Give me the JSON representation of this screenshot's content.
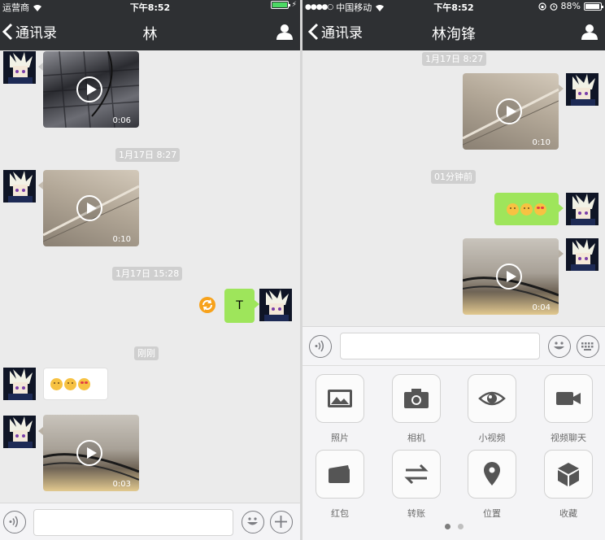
{
  "left": {
    "status": {
      "carrier": "运营商",
      "time": "下午8:52"
    },
    "nav": {
      "back_label": "通讯录",
      "title": "林"
    },
    "messages": {
      "video1_duration": "0:06",
      "stamp1": "1月17日 8:27",
      "video2_duration": "0:10",
      "stamp2": "1月17日 15:28",
      "text_message": "T",
      "stamp3": "刚刚",
      "video3_duration": "0:03"
    },
    "input": {
      "value": ""
    }
  },
  "right": {
    "status": {
      "carrier": "中国移动",
      "time": "下午8:52",
      "battery": "88%"
    },
    "nav": {
      "back_label": "通讯录",
      "title": "林洵锋"
    },
    "messages": {
      "stamp1": "1月17日 8:27",
      "video1_duration": "0:10",
      "stamp2": "01分钟前",
      "video2_duration": "0:04"
    },
    "input": {
      "value": ""
    },
    "tools": [
      {
        "label": "照片",
        "icon": "photo-icon"
      },
      {
        "label": "相机",
        "icon": "camera-icon"
      },
      {
        "label": "小视频",
        "icon": "eye-icon"
      },
      {
        "label": "视频聊天",
        "icon": "video-camera-icon"
      },
      {
        "label": "红包",
        "icon": "red-packet-icon"
      },
      {
        "label": "转账",
        "icon": "transfer-icon"
      },
      {
        "label": "位置",
        "icon": "location-pin-icon"
      },
      {
        "label": "收藏",
        "icon": "cube-icon"
      }
    ],
    "pager": {
      "page": 1,
      "total": 2
    }
  },
  "colors": {
    "navbar": "#2e3033",
    "chat_background": "#ebebeb",
    "sent_bubble": "#9ee55b",
    "timestamp_pill": "#cfcfcf",
    "resend_badge": "#f7a21b",
    "battery_fill": "#4cd964"
  }
}
